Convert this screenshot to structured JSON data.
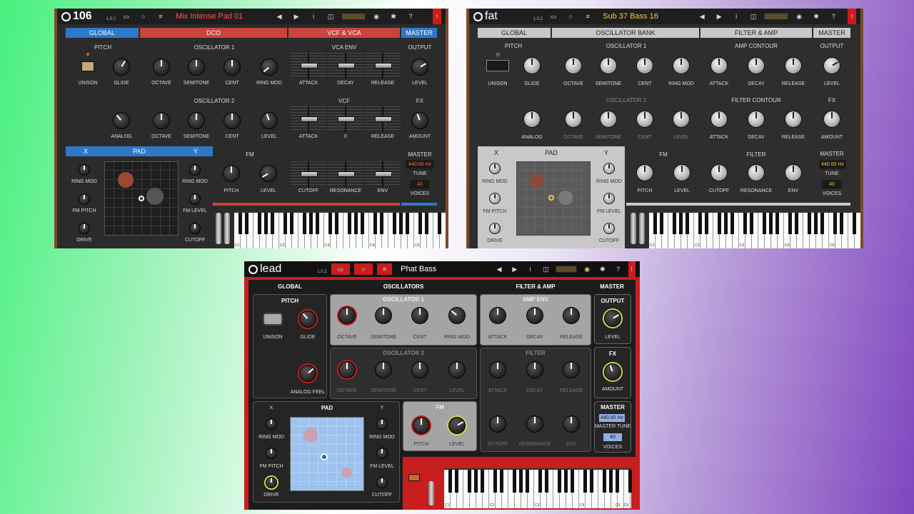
{
  "colors": {
    "red": "#c8443d",
    "blue": "#2f78c8",
    "lead_bg": "#c81e1e",
    "grey_header": "#c8c8c8"
  },
  "w106": {
    "title": "106",
    "version": "1.0.2",
    "preset": "Mix Intense Pad 01",
    "icons": [
      "folder-icon",
      "record-icon",
      "list-icon",
      "prev-icon",
      "next-icon",
      "info-icon",
      "camera-icon",
      "gear-icon",
      "help-icon",
      "close-icon"
    ],
    "sections": {
      "global": "GLOBAL",
      "dco": "DCO",
      "vcf": "VCF & VCA",
      "master": "MASTER",
      "pad": "PAD",
      "x": "X",
      "y": "Y"
    },
    "heads": {
      "pitch": "PITCH",
      "osc1": "OSCILLATOR 1",
      "osc2": "OSCILLATOR 2",
      "vcaenv": "VCA ENV",
      "vcf": "VCF",
      "output": "OUTPUT",
      "fx": "FX",
      "fm": "FM",
      "master": "MASTER"
    },
    "labels": {
      "unison": "UNISON",
      "glide": "GLIDE",
      "analog": "ANALOG",
      "octave": "OCTAVE",
      "semitone": "SEMITONE",
      "cent": "CENT",
      "ringmod": "RING MOD",
      "level": "LEVEL",
      "attack": "ATTACK",
      "decay": "DECAY",
      "release": "RELEASE",
      "zero": "0",
      "cutoff": "CUTOFF",
      "resonance": "RESONANCE",
      "env": "ENV",
      "amount": "AMOUNT",
      "pitch": "PITCH",
      "tune": "TUNE",
      "voices": "VOICES",
      "ringmod_x": "RING MOD",
      "fmpitch": "FM PITCH",
      "drive": "DRIVE",
      "ringmod_y": "RING MOD",
      "fmlevel": "FM LEVEL",
      "cutoff_y": "CUTOFF"
    },
    "hz": "440.00 Hz",
    "voices_val": "40",
    "keys": [
      "C1",
      "C2",
      "C3",
      "C4",
      "C5"
    ]
  },
  "wfat": {
    "title": "fat",
    "version": "1.0.2",
    "preset": "Sub 37 Bass 16",
    "sections": {
      "global": "GLOBAL",
      "osc": "OSCILLATOR BANK",
      "filter": "FILTER & AMP",
      "master": "MASTER",
      "pad": "PAD",
      "x": "X",
      "y": "Y"
    },
    "heads": {
      "pitch": "PITCH",
      "osc1": "OSCILLATOR 1",
      "osc2": "OSCILLATOR 2",
      "amp": "AMP CONTOUR",
      "filtc": "FILTER CONTOUR",
      "filter": "FILTER",
      "output": "OUTPUT",
      "fx": "FX",
      "fm": "FM",
      "master": "MASTER"
    },
    "labels": {
      "unison": "UNISON",
      "glide": "GLIDE",
      "analog": "ANALOG",
      "octave": "OCTAVE",
      "semitone": "SEMITONE",
      "cent": "CENT",
      "ringmod": "RING MOD",
      "level": "LEVEL",
      "attack": "ATTACK",
      "decay": "DECAY",
      "release": "RELEASE",
      "cutoff": "CUTOFF",
      "resonance": "RESONANCE",
      "env": "ENV",
      "amount": "AMOUNT",
      "pitch": "PITCH",
      "tune": "TUNE",
      "voices": "VOICES",
      "ringmod_x": "RING MOD",
      "fmpitch": "FM PITCH",
      "drive": "DRIVE",
      "ringmod_y": "RING MOD",
      "fmlevel": "FM LEVEL",
      "cutoff_y": "CUTOFF"
    },
    "hz": "440.00 Hz",
    "voices_val": "40",
    "keys": [
      "C1",
      "C2",
      "C3",
      "C4",
      "C5"
    ]
  },
  "wlead": {
    "title": "lead",
    "version": "1.0.2",
    "preset": "Phat Bass",
    "sections": {
      "global": "GLOBAL",
      "osc": "OSCILLATORS",
      "filter": "FILTER & AMP",
      "master": "MASTER"
    },
    "heads": {
      "pitch": "PITCH",
      "osc1": "OSCILLATOR 1",
      "osc2": "OSCILLATOR 2",
      "ampenv": "AMP ENV",
      "filter": "FILTER",
      "output": "OUTPUT",
      "fx": "FX",
      "master": "MASTER",
      "pad": "PAD",
      "fm": "FM",
      "x": "X",
      "y": "Y"
    },
    "labels": {
      "unison": "UNISON",
      "glide": "GLIDE",
      "analogfeel": "ANALOG FEEL",
      "octave": "OCTAVE",
      "semitone": "SEMITONE",
      "cent": "CENT",
      "ringmod": "RING MOD",
      "level": "LEVEL",
      "attack": "ATTACK",
      "decay": "DECAY",
      "release": "RELEASE",
      "cutoff": "CUTOFF",
      "resonance": "RESONANCE",
      "env": "ENV",
      "amount": "AMOUNT",
      "pitch": "PITCH",
      "mastertune": "MASTER TUNE",
      "voices": "VOICES",
      "ringmod_x": "RING MOD",
      "fmpitch": "FM PITCH",
      "drive": "DRIVE",
      "ringmod_y": "RING MOD",
      "fmlevel": "FM LEVEL",
      "cutoff_y": "CUTOFF"
    },
    "hz": "440.00 Hz",
    "voices_val": "40",
    "keys": [
      "C1",
      "C2",
      "C3",
      "C4",
      "C5",
      "C6"
    ]
  }
}
